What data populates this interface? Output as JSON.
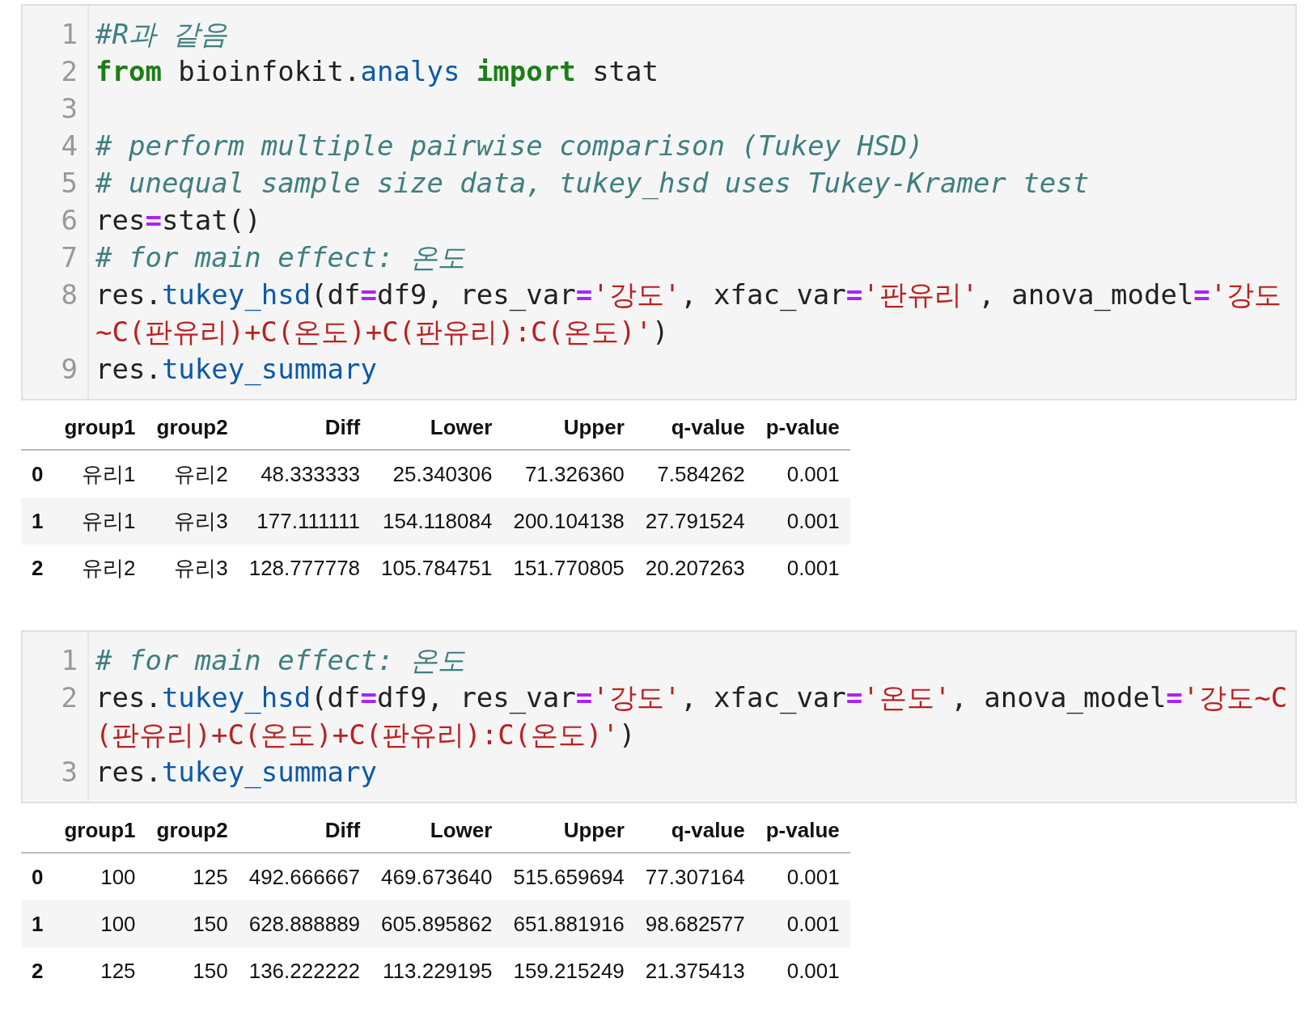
{
  "cells": [
    {
      "lines": [
        {
          "number": "1",
          "tokens": [
            {
              "kind": "comment",
              "text": "#R과 같음"
            }
          ]
        },
        {
          "number": "2",
          "tokens": [
            {
              "kind": "keyword",
              "text": "from"
            },
            {
              "kind": "plain",
              "text": " bioinfokit."
            },
            {
              "kind": "name",
              "text": "analys"
            },
            {
              "kind": "keyword",
              "text": " import"
            },
            {
              "kind": "plain",
              "text": " stat"
            }
          ]
        },
        {
          "number": "3"
        },
        {
          "number": "4",
          "tokens": [
            {
              "kind": "comment",
              "text": "# perform multiple pairwise comparison (Tukey HSD)"
            }
          ]
        },
        {
          "number": "5",
          "tokens": [
            {
              "kind": "comment",
              "text": "# unequal sample size data, tukey_hsd uses Tukey-Kramer test"
            }
          ]
        },
        {
          "number": "6",
          "tokens": [
            {
              "kind": "plain",
              "text": "res"
            },
            {
              "kind": "operator",
              "text": "="
            },
            {
              "kind": "plain",
              "text": "stat()"
            }
          ]
        },
        {
          "number": "7",
          "tokens": [
            {
              "kind": "comment",
              "text": "# for main effect: 온도"
            }
          ]
        },
        {
          "number": "8",
          "tokens": [
            {
              "kind": "plain",
              "text": "res."
            },
            {
              "kind": "name",
              "text": "tukey_hsd"
            },
            {
              "kind": "plain",
              "text": "(df"
            },
            {
              "kind": "operator",
              "text": "="
            },
            {
              "kind": "plain",
              "text": "df9, res_var"
            },
            {
              "kind": "operator",
              "text": "="
            },
            {
              "kind": "string",
              "text": "'강도'"
            },
            {
              "kind": "plain",
              "text": ", xfac_var"
            },
            {
              "kind": "operator",
              "text": "="
            },
            {
              "kind": "string",
              "text": "'판유리'"
            },
            {
              "kind": "plain",
              "text": ", anova_model"
            },
            {
              "kind": "operator",
              "text": "="
            },
            {
              "kind": "string",
              "text": "'강도~C(판유리)+C(온도)+C(판유리):C(온도)'"
            },
            {
              "kind": "plain",
              "text": ")"
            }
          ]
        },
        {
          "number": "9",
          "tokens": [
            {
              "kind": "plain",
              "text": "res."
            },
            {
              "kind": "name",
              "text": "tukey_summary"
            }
          ]
        }
      ],
      "output": {
        "columns": [
          "group1",
          "group2",
          "Diff",
          "Lower",
          "Upper",
          "q-value",
          "p-value"
        ],
        "rows": [
          {
            "index": "0",
            "cells": [
              "유리1",
              "유리2",
              "48.333333",
              "25.340306",
              "71.326360",
              "7.584262",
              "0.001"
            ]
          },
          {
            "index": "1",
            "cells": [
              "유리1",
              "유리3",
              "177.111111",
              "154.118084",
              "200.104138",
              "27.791524",
              "0.001"
            ]
          },
          {
            "index": "2",
            "cells": [
              "유리2",
              "유리3",
              "128.777778",
              "105.784751",
              "151.770805",
              "20.207263",
              "0.001"
            ]
          }
        ]
      }
    },
    {
      "lines": [
        {
          "number": "1",
          "tokens": [
            {
              "kind": "comment",
              "text": "# for main effect: 온도"
            }
          ]
        },
        {
          "number": "2",
          "tokens": [
            {
              "kind": "plain",
              "text": "res."
            },
            {
              "kind": "name",
              "text": "tukey_hsd"
            },
            {
              "kind": "plain",
              "text": "(df"
            },
            {
              "kind": "operator",
              "text": "="
            },
            {
              "kind": "plain",
              "text": "df9, res_var"
            },
            {
              "kind": "operator",
              "text": "="
            },
            {
              "kind": "string",
              "text": "'강도'"
            },
            {
              "kind": "plain",
              "text": ", xfac_var"
            },
            {
              "kind": "operator",
              "text": "="
            },
            {
              "kind": "string",
              "text": "'온도'"
            },
            {
              "kind": "plain",
              "text": ", anova_model"
            },
            {
              "kind": "operator",
              "text": "="
            },
            {
              "kind": "string",
              "text": "'강도~C(판유리)+C(온도)+C(판유리):C(온도)'"
            },
            {
              "kind": "plain",
              "text": ")"
            }
          ]
        },
        {
          "number": "3",
          "tokens": [
            {
              "kind": "plain",
              "text": "res."
            },
            {
              "kind": "name",
              "text": "tukey_summary"
            }
          ]
        }
      ],
      "output": {
        "columns": [
          "group1",
          "group2",
          "Diff",
          "Lower",
          "Upper",
          "q-value",
          "p-value"
        ],
        "rows": [
          {
            "index": "0",
            "cells": [
              "100",
              "125",
              "492.666667",
              "469.673640",
              "515.659694",
              "77.307164",
              "0.001"
            ]
          },
          {
            "index": "1",
            "cells": [
              "100",
              "150",
              "628.888889",
              "605.895862",
              "651.881916",
              "98.682577",
              "0.001"
            ]
          },
          {
            "index": "2",
            "cells": [
              "125",
              "150",
              "136.222222",
              "113.229195",
              "159.215249",
              "21.375413",
              "0.001"
            ]
          }
        ]
      }
    }
  ]
}
